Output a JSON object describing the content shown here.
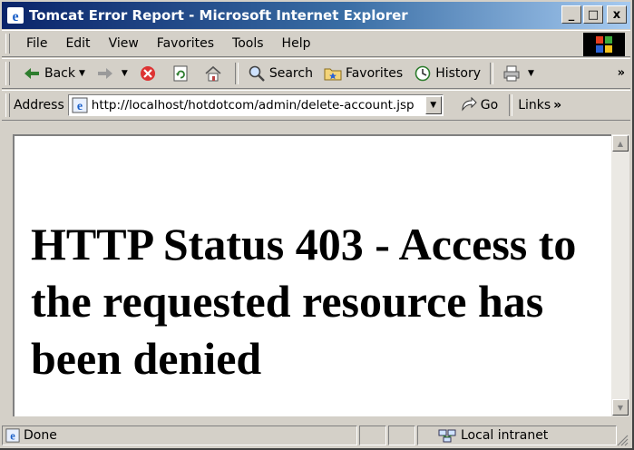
{
  "window": {
    "title": "Tomcat Error Report - Microsoft Internet Explorer",
    "minimize_label": "_",
    "maximize_label": "□",
    "close_label": "x"
  },
  "menu": [
    "File",
    "Edit",
    "View",
    "Favorites",
    "Tools",
    "Help"
  ],
  "toolbar": {
    "back_label": "Back",
    "search_label": "Search",
    "favorites_label": "Favorites",
    "history_label": "History",
    "more_label": "»"
  },
  "address": {
    "label": "Address",
    "url": "http://localhost/hotdotcom/admin/delete-account.jsp",
    "go_label": "Go",
    "links_label": "Links",
    "links_more": "»"
  },
  "page": {
    "heading": "HTTP Status 403 - Access to the requested resource has been denied"
  },
  "status": {
    "text": "Done",
    "zone": "Local intranet"
  },
  "colors": {
    "titlebar_start": "#0a246a",
    "titlebar_end": "#a6caf0",
    "chrome": "#d4d0c8"
  }
}
